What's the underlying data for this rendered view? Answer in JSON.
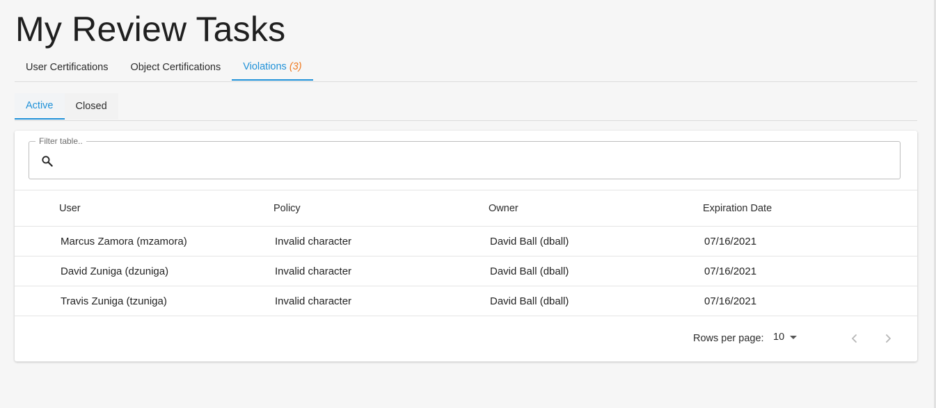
{
  "page": {
    "title": "My Review Tasks"
  },
  "tabs": [
    {
      "label": "User Certifications"
    },
    {
      "label": "Object Certifications"
    },
    {
      "label": "Violations",
      "count": "(3)",
      "active": true
    }
  ],
  "subtabs": [
    {
      "label": "Active",
      "active": true
    },
    {
      "label": "Closed"
    }
  ],
  "filter": {
    "label": "Filter table..",
    "value": "",
    "icon": "search-icon"
  },
  "table": {
    "headers": [
      "User",
      "Policy",
      "Owner",
      "Expiration Date"
    ],
    "rows": [
      [
        "Marcus Zamora (mzamora)",
        "Invalid character",
        "David Ball (dball)",
        "07/16/2021"
      ],
      [
        "David Zuniga (dzuniga)",
        "Invalid character",
        "David Ball (dball)",
        "07/16/2021"
      ],
      [
        "Travis Zuniga (tzuniga)",
        "Invalid character",
        "David Ball (dball)",
        "07/16/2021"
      ]
    ]
  },
  "pagination": {
    "rows_per_page_label": "Rows per page:",
    "rows_per_page_value": "10",
    "prev_icon": "chevron-left-icon",
    "next_icon": "chevron-right-icon"
  },
  "colors": {
    "accent": "#1f91d8",
    "count": "#ef7a22",
    "background": "#f6f6f6"
  }
}
